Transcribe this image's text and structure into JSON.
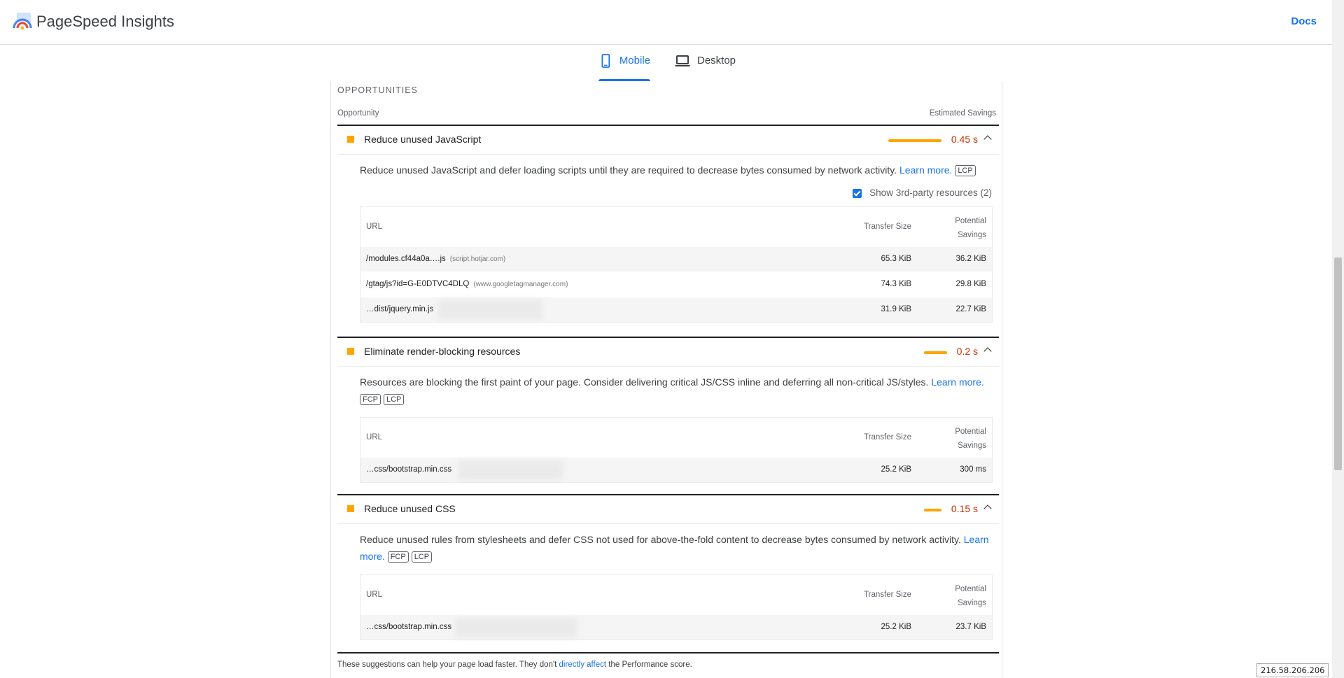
{
  "header": {
    "brand": "PageSpeed Insights",
    "docs_label": "Docs"
  },
  "tabs": [
    {
      "label": "Mobile",
      "icon": "phone-icon",
      "active": true
    },
    {
      "label": "Desktop",
      "icon": "laptop-icon",
      "active": false
    }
  ],
  "section": {
    "title": "OPPORTUNITIES",
    "col_opportunity": "Opportunity",
    "col_savings": "Estimated Savings"
  },
  "table_headers": {
    "url": "URL",
    "transfer": "Transfer Size",
    "potential_1": "Potential",
    "potential_2": "Savings"
  },
  "audits": [
    {
      "title": "Reduce unused JavaScript",
      "savings": "0.45 s",
      "savings_fraction": 1.0,
      "description": "Reduce unused JavaScript and defer loading scripts until they are required to decrease bytes consumed by network activity. ",
      "learn_more": "Learn more.",
      "tags": [
        "LCP"
      ],
      "third_party_label": "Show 3rd-party resources (2)",
      "rows": [
        {
          "url": "/modules.cf44a0a….js",
          "host": "(script.hotjar.com)",
          "transfer": "65.3 KiB",
          "savings": "36.2 KiB"
        },
        {
          "url": "/gtag/js?id=G-E0DTVC4DLQ",
          "host": "(www.googletagmanager.com)",
          "transfer": "74.3 KiB",
          "savings": "29.8 KiB"
        },
        {
          "url": "…dist/jquery.min.js",
          "host": "",
          "transfer": "31.9 KiB",
          "savings": "22.7 KiB"
        }
      ]
    },
    {
      "title": "Eliminate render-blocking resources",
      "savings": "0.2 s",
      "savings_fraction": 0.44,
      "description": "Resources are blocking the first paint of your page. Consider delivering critical JS/CSS inline and deferring all non-critical JS/styles. ",
      "learn_more": "Learn more.",
      "tags": [
        "FCP",
        "LCP"
      ],
      "rows": [
        {
          "url": "…css/bootstrap.min.css",
          "host": "",
          "transfer": "25.2 KiB",
          "savings": "300 ms"
        }
      ]
    },
    {
      "title": "Reduce unused CSS",
      "savings": "0.15 s",
      "savings_fraction": 0.33,
      "description": "Reduce unused rules from stylesheets and defer CSS not used for above-the-fold content to decrease bytes consumed by network activity. ",
      "learn_more": "Learn more.",
      "tags": [
        "FCP",
        "LCP"
      ],
      "rows": [
        {
          "url": "…css/bootstrap.min.css",
          "host": "",
          "transfer": "25.2 KiB",
          "savings": "23.7 KiB"
        }
      ]
    }
  ],
  "footer": {
    "text_before": "These suggestions can help your page load faster. They don't ",
    "link": "directly affect",
    "text_after": " the Performance score."
  },
  "ip_badge": "216.58.206.206",
  "colors": {
    "accent": "#1a73e8",
    "warning": "#ffa400",
    "savings_text": "#c33300"
  }
}
